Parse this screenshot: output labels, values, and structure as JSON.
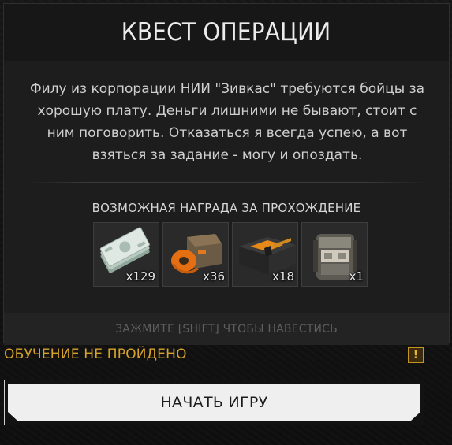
{
  "dialog": {
    "title": "КВЕСТ ОПЕРАЦИИ",
    "description": "Филу из корпорации НИИ \"Зивкас\" требуются бойцы за хорошую плату. Деньги лишними не бывают, стоит с ним поговорить. Отказаться я всегда успею, а вот взяться за задание - могу и опоздать.",
    "reward_heading": "ВОЗМОЖНАЯ НАГРАДА ЗА ПРОХОЖДЕНИЕ",
    "rewards": [
      {
        "icon": "money-stack-icon",
        "count": "x129"
      },
      {
        "icon": "orange-tape-roll-icon",
        "count": "x36"
      },
      {
        "icon": "hazard-ammo-box-icon",
        "count": "x18"
      },
      {
        "icon": "armor-vest-icon",
        "count": "x1"
      }
    ],
    "hint": "ЗАЖМИТЕ [SHIFT] ЧТОБЫ НАВЕСТИСЬ"
  },
  "status": {
    "text": "ОБУЧЕНИЕ НЕ ПРОЙДЕНО",
    "warning_glyph": "!",
    "color": "#d8a32c"
  },
  "start_button": {
    "label": "НАЧАТЬ ИГРУ"
  }
}
